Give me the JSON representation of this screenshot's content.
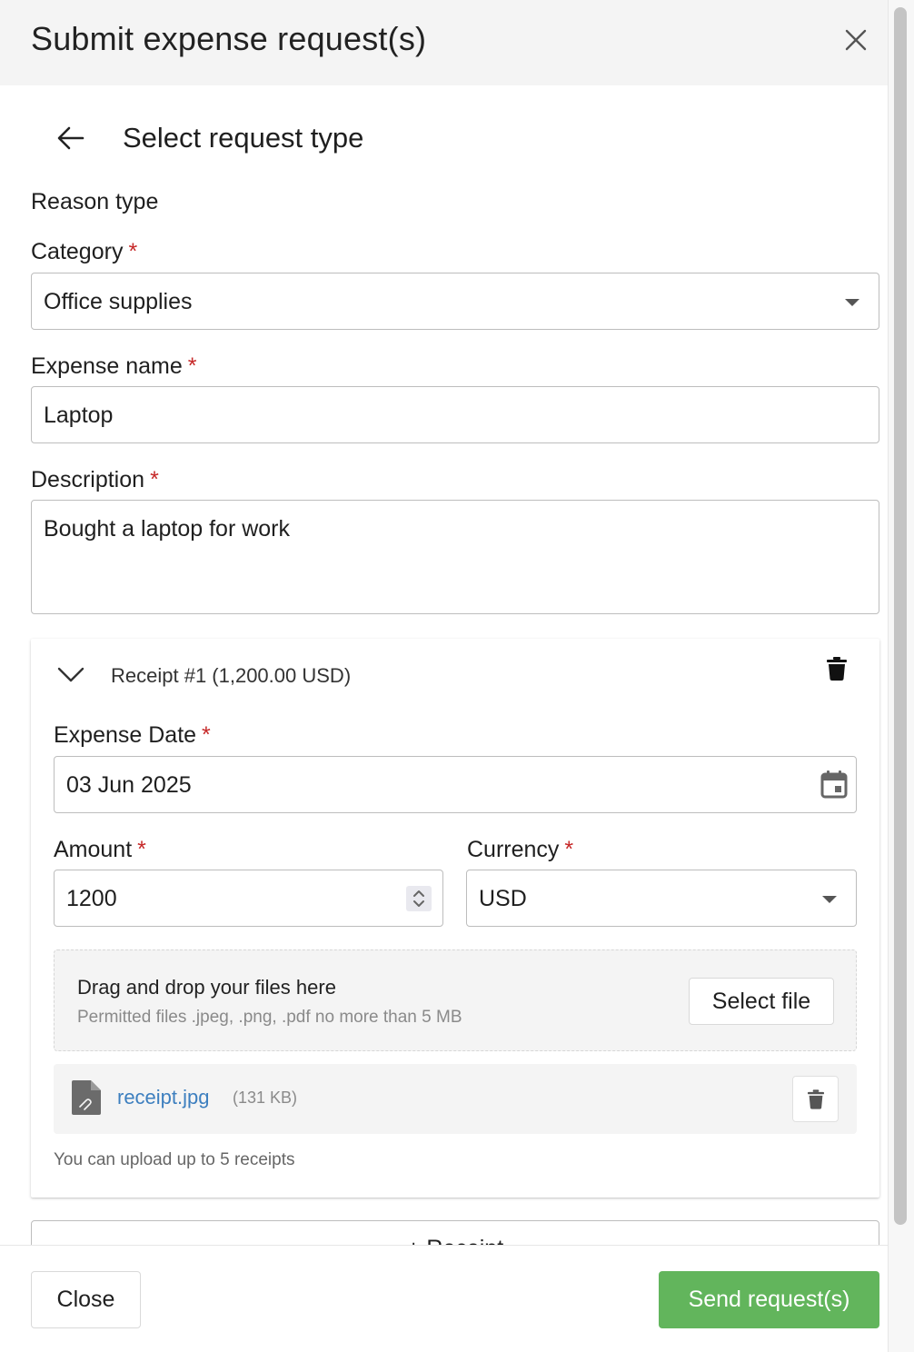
{
  "dialog": {
    "title": "Submit expense request(s)"
  },
  "form": {
    "subtitle": "Select request type",
    "section_label": "Reason type",
    "category": {
      "label": "Category",
      "required_mark": "*",
      "value": "Office supplies"
    },
    "expense_name": {
      "label": "Expense name",
      "required_mark": "*",
      "value": "Laptop"
    },
    "description": {
      "label": "Description",
      "required_mark": "*",
      "value": "Bought a laptop for work"
    }
  },
  "receipt": {
    "title": "Receipt #1 (1,200.00 USD)",
    "expense_date": {
      "label": "Expense Date",
      "required_mark": "*",
      "value": "03 Jun 2025"
    },
    "amount": {
      "label": "Amount",
      "required_mark": "*",
      "value": "1200"
    },
    "currency": {
      "label": "Currency",
      "required_mark": "*",
      "value": "USD"
    },
    "dropzone": {
      "title": "Drag and drop your files here",
      "hint": "Permitted files .jpeg, .png, .pdf no more than 5 MB",
      "button_label": "Select file"
    },
    "file": {
      "name": "receipt.jpg",
      "size": "(131 KB)"
    },
    "upload_note": "You can upload up to 5 receipts"
  },
  "add_receipt": {
    "label": "+ Receipt"
  },
  "footer": {
    "close_label": "Close",
    "send_label": "Send request(s)"
  },
  "icons": {
    "close": "close-icon",
    "back": "arrow-left-icon",
    "chevron": "chevron-down-icon",
    "trash": "trash-icon",
    "calendar": "calendar-icon",
    "stepper": "stepper-icon",
    "file": "file-attachment-icon"
  },
  "colors": {
    "required": "#c62828",
    "primary_button": "#62b55c",
    "link": "#3d7fbf",
    "header_bg": "#f4f4f4"
  }
}
